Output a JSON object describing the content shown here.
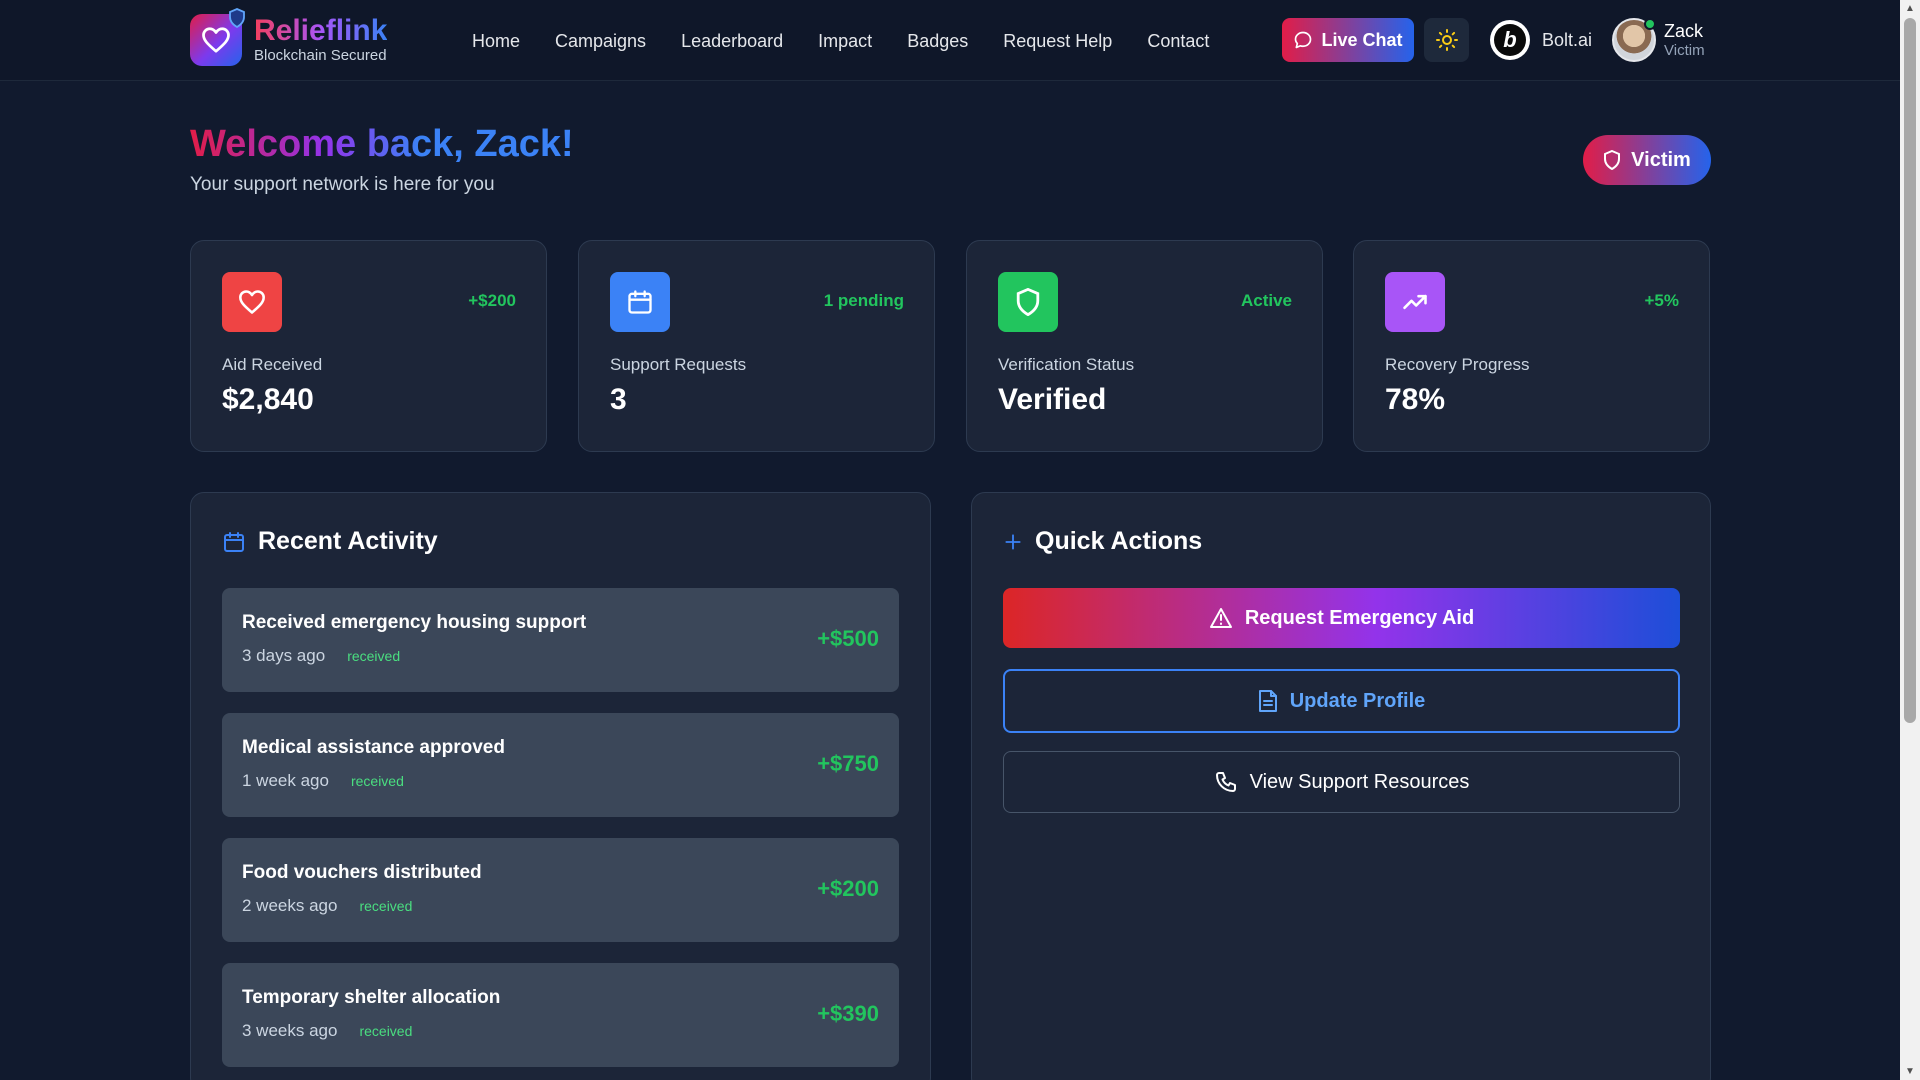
{
  "brand": {
    "name": "Relieflink",
    "tagline": "Blockchain Secured"
  },
  "nav": [
    "Home",
    "Campaigns",
    "Leaderboard",
    "Impact",
    "Badges",
    "Request Help",
    "Contact"
  ],
  "header": {
    "live_chat": "Live Chat",
    "bolt_label": "Bolt.ai",
    "bolt_letter": "b",
    "user_name": "Zack",
    "user_role": "Victim"
  },
  "welcome": {
    "title": "Welcome back, Zack!",
    "subtitle": "Your support network is here for you",
    "role_badge": "Victim"
  },
  "stats": [
    {
      "label": "Aid Received",
      "value": "$2,840",
      "badge": "+$200",
      "icon": "heart-icon",
      "color": "#ef4444"
    },
    {
      "label": "Support Requests",
      "value": "3",
      "badge": "1 pending",
      "icon": "calendar-icon",
      "color": "#3b82f6"
    },
    {
      "label": "Verification Status",
      "value": "Verified",
      "badge": "Active",
      "icon": "shield-icon",
      "color": "#22c55e"
    },
    {
      "label": "Recovery Progress",
      "value": "78%",
      "badge": "+5%",
      "icon": "trending-up-icon",
      "color": "#a855f7"
    }
  ],
  "recent_activity": {
    "title": "Recent Activity",
    "items": [
      {
        "title": "Received emergency housing support",
        "time": "3 days ago",
        "status": "received",
        "amount": "+$500"
      },
      {
        "title": "Medical assistance approved",
        "time": "1 week ago",
        "status": "received",
        "amount": "+$750"
      },
      {
        "title": "Food vouchers distributed",
        "time": "2 weeks ago",
        "status": "received",
        "amount": "+$200"
      },
      {
        "title": "Temporary shelter allocation",
        "time": "3 weeks ago",
        "status": "received",
        "amount": "+$390"
      }
    ]
  },
  "quick_actions": {
    "title": "Quick Actions",
    "emergency": "Request Emergency Aid",
    "profile": "Update Profile",
    "resources": "View Support Resources"
  },
  "colors": {
    "accent_red": "#e11d48",
    "accent_blue": "#2563eb",
    "success": "#22c55e",
    "background": "#111a2e",
    "card": "#1c2538"
  }
}
